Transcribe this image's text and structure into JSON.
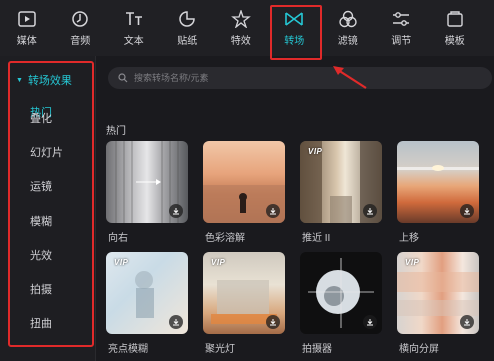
{
  "toolbar": {
    "items": [
      {
        "label": "媒体",
        "icon": "media-icon"
      },
      {
        "label": "音频",
        "icon": "audio-icon"
      },
      {
        "label": "文本",
        "icon": "text-icon"
      },
      {
        "label": "贴纸",
        "icon": "sticker-icon"
      },
      {
        "label": "特效",
        "icon": "effects-icon"
      },
      {
        "label": "转场",
        "icon": "transition-icon",
        "active": true
      },
      {
        "label": "滤镜",
        "icon": "filter-icon"
      },
      {
        "label": "调节",
        "icon": "adjust-icon"
      },
      {
        "label": "模板",
        "icon": "template-icon"
      }
    ]
  },
  "sidebar": {
    "header": "转场效果",
    "items": [
      {
        "label": "热门",
        "active": true
      },
      {
        "label": "叠化"
      },
      {
        "label": "幻灯片"
      },
      {
        "label": "运镜"
      },
      {
        "label": "模糊"
      },
      {
        "label": "光效"
      },
      {
        "label": "拍摄"
      },
      {
        "label": "扭曲"
      }
    ]
  },
  "search": {
    "placeholder": "搜索转场名称/元素"
  },
  "section": {
    "title": "热门"
  },
  "cards": [
    {
      "label": "向右",
      "vip": false
    },
    {
      "label": "色彩溶解",
      "vip": false
    },
    {
      "label": "推近 II",
      "vip": true,
      "vip_text": "VIP"
    },
    {
      "label": "上移",
      "vip": false
    },
    {
      "label": "亮点模糊",
      "vip": true,
      "vip_text": "VIP"
    },
    {
      "label": "聚光灯",
      "vip": true,
      "vip_text": "VIP"
    },
    {
      "label": "拍摄器",
      "vip": false
    },
    {
      "label": "横向分屏",
      "vip": true,
      "vip_text": "VIP"
    }
  ],
  "colors": {
    "accent": "#25c7d4",
    "highlight": "#e02a2a",
    "background": "#1a1a1e"
  }
}
